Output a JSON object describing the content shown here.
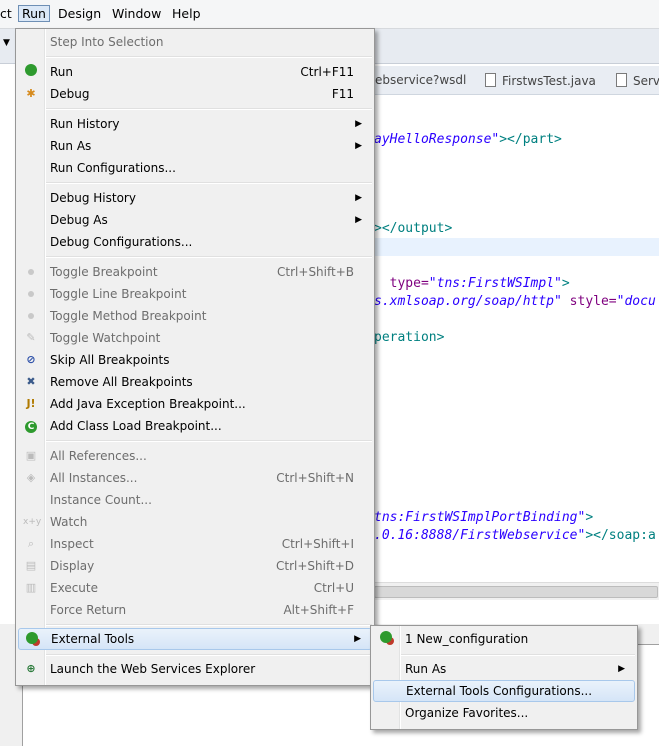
{
  "menubar": {
    "items": [
      {
        "label": "ct"
      },
      {
        "label": "Run"
      },
      {
        "label": "Design"
      },
      {
        "label": "Window"
      },
      {
        "label": "Help"
      }
    ]
  },
  "editor": {
    "tabs": [
      {
        "label": "ebservice?wsdl"
      },
      {
        "label": "FirstwsTest.java"
      },
      {
        "label": "Serv"
      }
    ],
    "code_lines": [
      {
        "a": "ayHelloResponse\"",
        "b": "></part>"
      },
      {
        "a": "",
        "b": "></output>"
      },
      {
        "a": "type=",
        "b": "\"tns:FirstWSImpl\"",
        "c": ">"
      },
      {
        "a": "s.xmlsoap.org/soap/http\"",
        "b": " style=",
        "c": "\"docu"
      },
      {
        "a": "peration>"
      },
      {
        "a": "tns:FirstWSImplPortBinding\"",
        "b": ">"
      },
      {
        "a": ".0.16:8888/FirstWebservice\"",
        "b": "></soap:a"
      }
    ]
  },
  "run_menu": {
    "items": [
      {
        "label": "Step Into Selection",
        "icon": "none"
      },
      {
        "label": "Run",
        "accel": "Ctrl+F11",
        "icon": "run-icon"
      },
      {
        "label": "Debug",
        "accel": "F11",
        "icon": "debug-icon"
      },
      {
        "label": "Run History",
        "icon": "none"
      },
      {
        "label": "Run As",
        "icon": "none"
      },
      {
        "label": "Run Configurations...",
        "icon": "none"
      },
      {
        "label": "Debug History",
        "icon": "none"
      },
      {
        "label": "Debug As",
        "icon": "none"
      },
      {
        "label": "Debug Configurations...",
        "icon": "none"
      },
      {
        "label": "Toggle Breakpoint",
        "accel": "Ctrl+Shift+B",
        "icon": "breakpoint-icon"
      },
      {
        "label": "Toggle Line Breakpoint",
        "icon": "breakpoint-icon"
      },
      {
        "label": "Toggle Method Breakpoint",
        "icon": "breakpoint-icon"
      },
      {
        "label": "Toggle Watchpoint",
        "icon": "watchpoint-icon"
      },
      {
        "label": "Skip All Breakpoints",
        "icon": "skip-breakpoints-icon"
      },
      {
        "label": "Remove All Breakpoints",
        "icon": "remove-breakpoints-icon"
      },
      {
        "label": "Add Java Exception Breakpoint...",
        "icon": "exception-icon"
      },
      {
        "label": "Add Class Load Breakpoint...",
        "icon": "class-load-icon"
      },
      {
        "label": "All References...",
        "icon": "references-icon"
      },
      {
        "label": "All Instances...",
        "accel": "Ctrl+Shift+N",
        "icon": "instances-icon"
      },
      {
        "label": "Instance Count...",
        "icon": "none"
      },
      {
        "label": "Watch",
        "icon": "watch-icon"
      },
      {
        "label": "Inspect",
        "accel": "Ctrl+Shift+I",
        "icon": "inspect-icon"
      },
      {
        "label": "Display",
        "accel": "Ctrl+Shift+D",
        "icon": "display-icon"
      },
      {
        "label": "Execute",
        "accel": "Ctrl+U",
        "icon": "execute-icon"
      },
      {
        "label": "Force Return",
        "accel": "Alt+Shift+F",
        "icon": "none"
      },
      {
        "label": "External Tools",
        "icon": "external-tools-icon"
      },
      {
        "label": "Launch the Web Services Explorer",
        "icon": "web-services-icon"
      }
    ]
  },
  "external_tools_menu": {
    "items": [
      {
        "label": "1 New_configuration",
        "icon": "external-tools-icon"
      },
      {
        "label": "Run As"
      },
      {
        "label": "External Tools Configurations..."
      },
      {
        "label": "Organize Favorites..."
      }
    ]
  },
  "colors": {
    "accent": "#dbe8f7",
    "run_green": "#2e9a2e",
    "debug_orange": "#d68a1c",
    "string_blue": "#2a00ff",
    "tag_teal": "#008080"
  }
}
